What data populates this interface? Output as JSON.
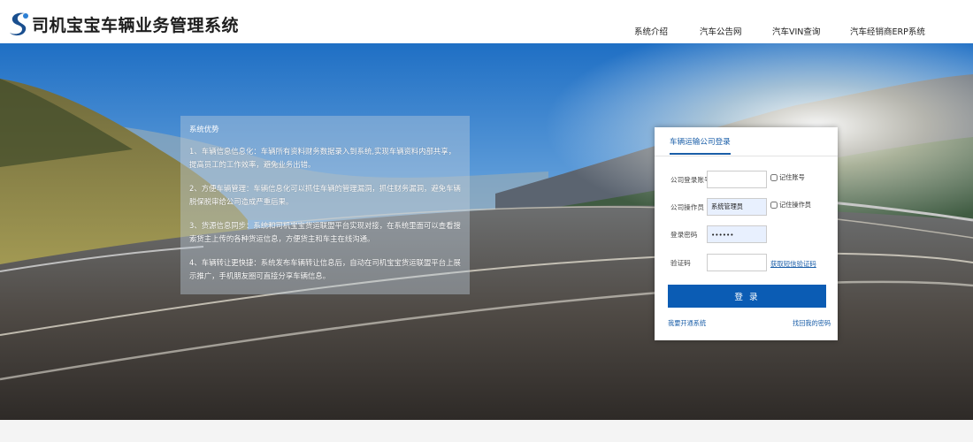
{
  "header": {
    "title": "司机宝宝车辆业务管理系统",
    "nav": [
      "系统介绍",
      "汽车公告网",
      "汽车VIN查询",
      "汽车经销商ERP系统"
    ]
  },
  "info_panel": {
    "heading": "系统优势",
    "items": [
      "1、车辆信息信息化：车辆所有资料财务数据录入到系统,实现车辆资料内部共享，提高员工的工作效率，避免业务出错。",
      "2、方便车辆管理：车辆信息化可以抓住车辆的管理漏洞，抓住财务漏洞，避免车辆脱保脱审给公司造成严重后果。",
      "3、货源信息同步：系统和司机宝宝货运联盟平台实现对接，在系统里面可以查看搜索货主上传的各种货运信息，方便货主和车主在线沟通。",
      "4、车辆转让更快捷：系统发布车辆转让信息后，自动在司机宝宝货运联盟平台上展示推广，手机朋友圈可直接分享车辆信息。"
    ]
  },
  "login": {
    "tab": "车辆运输公司登录",
    "account_label": "公司登录账号",
    "account_value": "",
    "remember_account": "记住账号",
    "operator_label": "公司操作员",
    "operator_value": "系统管理员",
    "remember_operator": "记住操作员",
    "password_label": "登录密码",
    "password_value": "123456",
    "captcha_label": "验证码",
    "captcha_value": "",
    "captcha_link": "获取短信验证码",
    "submit": "登 录",
    "register_link": "我要开通系统",
    "forgot_link": "找回我的密码"
  },
  "colors": {
    "accent": "#0b5cb4",
    "link": "#1a5ea8"
  }
}
